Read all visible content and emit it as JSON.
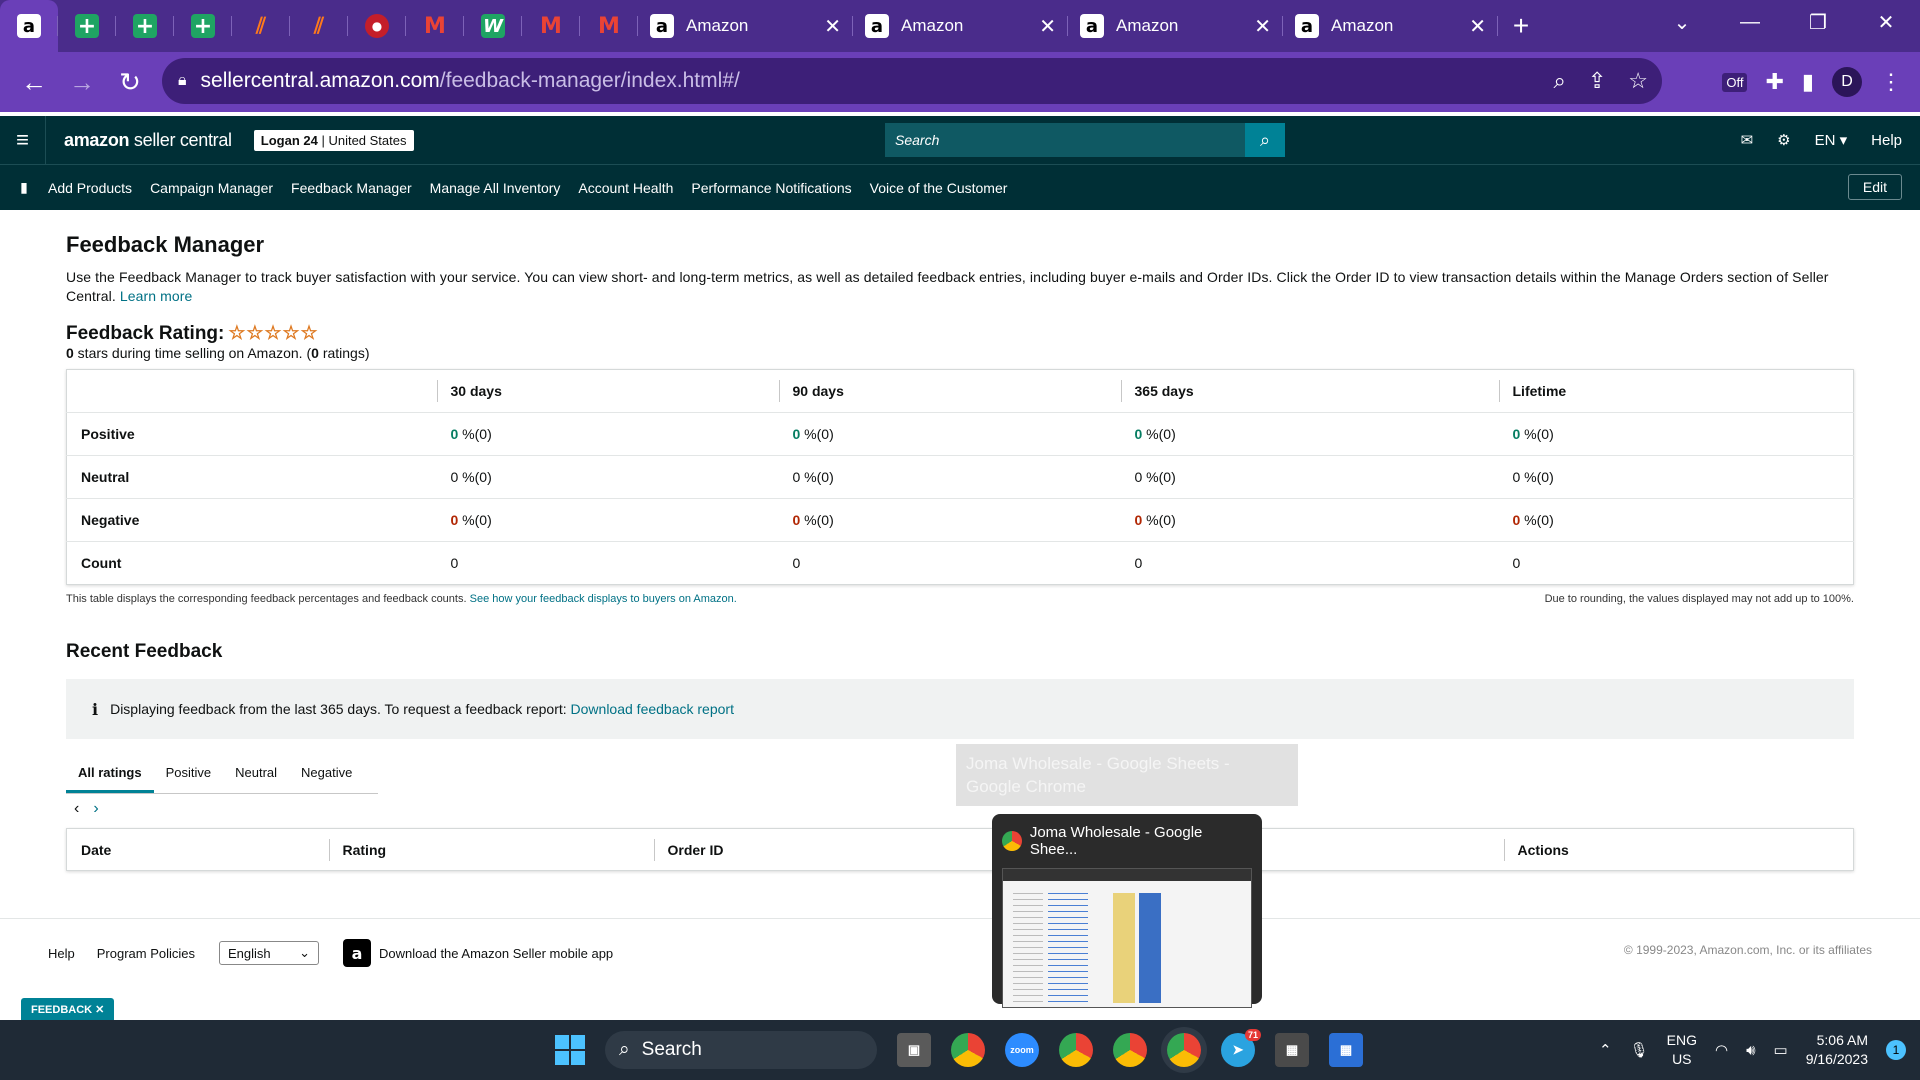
{
  "browser": {
    "pinned_tabs": [
      {
        "icon": "amazon-icon"
      },
      {
        "icon": "sheets-icon"
      },
      {
        "icon": "sheets-icon"
      },
      {
        "icon": "sheets-icon"
      },
      {
        "icon": "zapier-icon"
      },
      {
        "icon": "zapier-icon"
      },
      {
        "icon": "red-icon"
      },
      {
        "icon": "gmail-icon"
      },
      {
        "icon": "wn-icon"
      },
      {
        "icon": "gmail-icon"
      },
      {
        "icon": "gmail-icon"
      }
    ],
    "tabs": [
      {
        "label": "Amazon",
        "close": "✕"
      },
      {
        "label": "Amazon",
        "close": "✕"
      },
      {
        "label": "Amazon",
        "close": "✕"
      },
      {
        "label": "Amazon",
        "close": "✕"
      }
    ],
    "new_tab": "+",
    "url_host": "sellercentral.amazon.com",
    "url_path": "/feedback-manager/index.html#/",
    "extension_badge": "Off",
    "profile_initial": "D"
  },
  "header": {
    "logo_bold": "amazon",
    "logo_rest": " seller central",
    "store_name": "Logan 24",
    "store_region": " | United States",
    "search_placeholder": "Search",
    "language": "EN ▾",
    "help": "Help"
  },
  "nav": {
    "items": [
      "Add Products",
      "Campaign Manager",
      "Feedback Manager",
      "Manage All Inventory",
      "Account Health",
      "Performance Notifications",
      "Voice of the Customer"
    ],
    "edit": "Edit"
  },
  "page": {
    "title": "Feedback Manager",
    "intro": "Use the Feedback Manager to track buyer satisfaction with your service. You can view short- and long-term metrics, as well as detailed feedback entries, including buyer e-mails and Order IDs. Click the Order ID to view transaction details within the Manage Orders section of Seller Central.",
    "learn_more": "Learn more",
    "rating_title": "Feedback Rating:",
    "stars": "☆☆☆☆☆",
    "rating_stars_value": "0",
    "rating_sub_mid": " stars during time selling on Amazon. (",
    "rating_count": "0",
    "rating_sub_end": " ratings)",
    "table": {
      "columns": [
        "",
        "30 days",
        "90 days",
        "365 days",
        "Lifetime"
      ],
      "rows": [
        {
          "label": "Positive",
          "values": [
            "0",
            "0",
            "0",
            "0"
          ],
          "suffix": " %(0)",
          "tone": "g"
        },
        {
          "label": "Neutral",
          "values": [
            "0",
            "0",
            "0",
            "0"
          ],
          "suffix": " %(0)",
          "tone": ""
        },
        {
          "label": "Negative",
          "values": [
            "0",
            "0",
            "0",
            "0"
          ],
          "suffix": " %(0)",
          "tone": "r"
        },
        {
          "label": "Count",
          "values": [
            "0",
            "0",
            "0",
            "0"
          ],
          "suffix": "",
          "tone": ""
        }
      ]
    },
    "table_note": "This table displays the corresponding feedback percentages and feedback counts.",
    "table_note_link": "See how your feedback displays to buyers on Amazon.",
    "rounding_note": "Due to rounding, the values displayed may not add up to 100%.",
    "recent_title": "Recent Feedback",
    "info_icon": "i",
    "info_text": "Displaying feedback from the last 365 days. To request a feedback report:",
    "info_link": "Download feedback report",
    "filter_tabs": [
      "All ratings",
      "Positive",
      "Neutral",
      "Negative"
    ],
    "pager_prev": "‹",
    "pager_next": "›",
    "recent_columns": [
      "Date",
      "Rating",
      "Order ID",
      "",
      "Actions"
    ]
  },
  "footer": {
    "help": "Help",
    "program_policies": "Program Policies",
    "language": "English",
    "app_text": "Download the Amazon Seller mobile app",
    "copyright": "© 1999-2023, Amazon.com, Inc. or its affiliates",
    "feedback_tab": "FEEDBACK ✕"
  },
  "taskbar_preview": {
    "tooltip": "Joma Wholesale - Google Sheets - Google Chrome",
    "title": "Joma Wholesale - Google Shee..."
  },
  "taskbar": {
    "search": "Search",
    "lang_top": "ENG",
    "lang_bottom": "US",
    "time": "5:06 AM",
    "date": "9/16/2023",
    "notifications": "1",
    "telegram_badge": "71"
  }
}
